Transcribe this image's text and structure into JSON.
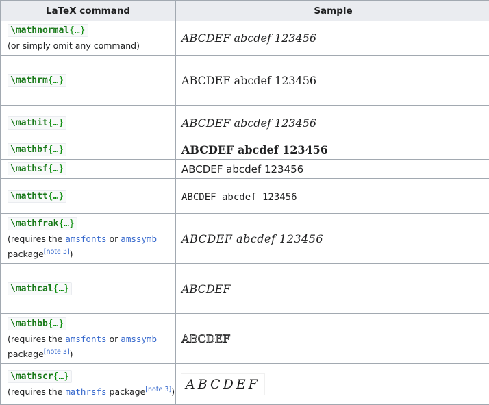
{
  "header": {
    "col1": "LaTeX command",
    "col2": "Sample"
  },
  "rows": [
    {
      "cmd": "\\mathnormal",
      "args": "{…}",
      "note_pre": "(or simply omit any command)",
      "sample": "ABCDEF abcdef 123456"
    },
    {
      "cmd": "\\mathrm",
      "args": "{…}",
      "sample": "ABCDEF abcdef 123456"
    },
    {
      "cmd": "\\mathit",
      "args": "{…}",
      "sample": "ABCDEF abcdef 123456"
    },
    {
      "cmd": "\\mathbf",
      "args": "{…}",
      "sample": "ABCDEF abcdef 123456"
    },
    {
      "cmd": "\\mathsf",
      "args": "{…}",
      "sample": "ABCDEF abcdef 123456"
    },
    {
      "cmd": "\\mathtt",
      "args": "{…}",
      "sample": "ABCDEF abcdef 123456"
    },
    {
      "cmd": "\\mathfrak",
      "args": "{…}",
      "req_pre": "(requires the",
      "pkg1": "amsfonts",
      "or": "or",
      "pkg2": "amssymb",
      "pkg_word": "package",
      "note": "[note 3]",
      "close": ")",
      "sample": "ABCDEF abcdef 123456"
    },
    {
      "cmd": "\\mathcal",
      "args": "{…}",
      "sample": "ABCDEF"
    },
    {
      "cmd": "\\mathbb",
      "args": "{…}",
      "req_pre": "(requires the",
      "pkg1": "amsfonts",
      "or": "or",
      "pkg2": "amssymb",
      "pkg_word": "package",
      "note": "[note 3]",
      "close": ")",
      "sample": "ABCDEF"
    },
    {
      "cmd": "\\mathscr",
      "args": "{…}",
      "req_pre": "(requires the",
      "pkg1": "mathrsfs",
      "pkg_word": "package",
      "note": "[note 3]",
      "close": ")",
      "sample": "ABCDEF"
    }
  ]
}
